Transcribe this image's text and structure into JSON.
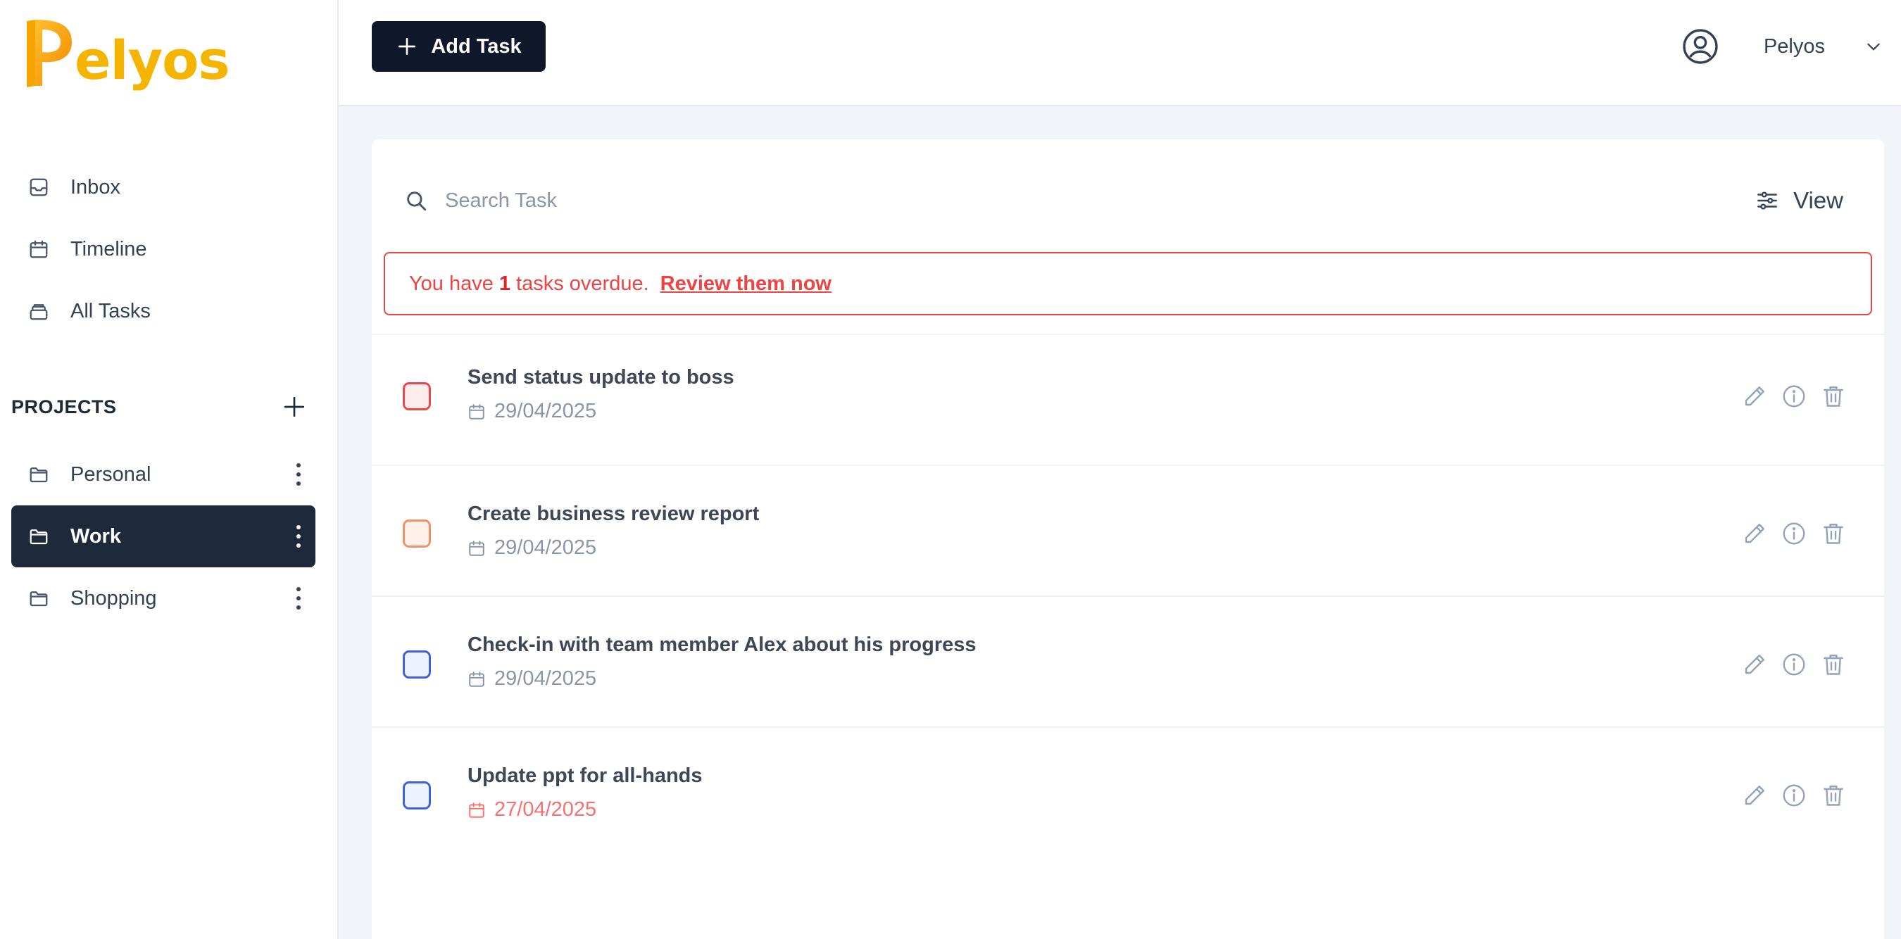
{
  "brand": {
    "logo_letter": "P",
    "name": "elyos",
    "color": "#f4b400"
  },
  "nav": {
    "items": [
      {
        "label": "Inbox",
        "icon": "inbox-icon"
      },
      {
        "label": "Timeline",
        "icon": "calendar-icon"
      },
      {
        "label": "All Tasks",
        "icon": "stack-icon"
      }
    ]
  },
  "projects": {
    "title": "PROJECTS",
    "items": [
      {
        "label": "Personal",
        "active": false
      },
      {
        "label": "Work",
        "active": true
      },
      {
        "label": "Shopping",
        "active": false
      }
    ]
  },
  "header": {
    "add_label": "Add Task",
    "user_name": "Pelyos"
  },
  "search": {
    "placeholder": "Search Task",
    "view_label": "View"
  },
  "alert": {
    "prefix": "You have",
    "count": "1",
    "suffix": "tasks overdue.",
    "link": "Review them now"
  },
  "tasks": [
    {
      "title": "Send status update to boss",
      "date": "29/04/2025",
      "overdue": false,
      "priority_color": "#e5484d",
      "fill": "#fdecee"
    },
    {
      "title": "Create business review report",
      "date": "29/04/2025",
      "overdue": false,
      "priority_color": "#f0916b",
      "fill": "#fff1ea"
    },
    {
      "title": "Check-in with team member Alex about his progress",
      "date": "29/04/2025",
      "overdue": false,
      "priority_color": "#3b63e0",
      "fill": "#eef2ff"
    },
    {
      "title": "Update ppt for all-hands",
      "date": "27/04/2025",
      "overdue": true,
      "priority_color": "#3b63e0",
      "fill": "#eef2ff"
    }
  ],
  "colors": {
    "overdue": "#ef4444",
    "dark": "#0f172a",
    "active_bg": "#1e293b"
  }
}
